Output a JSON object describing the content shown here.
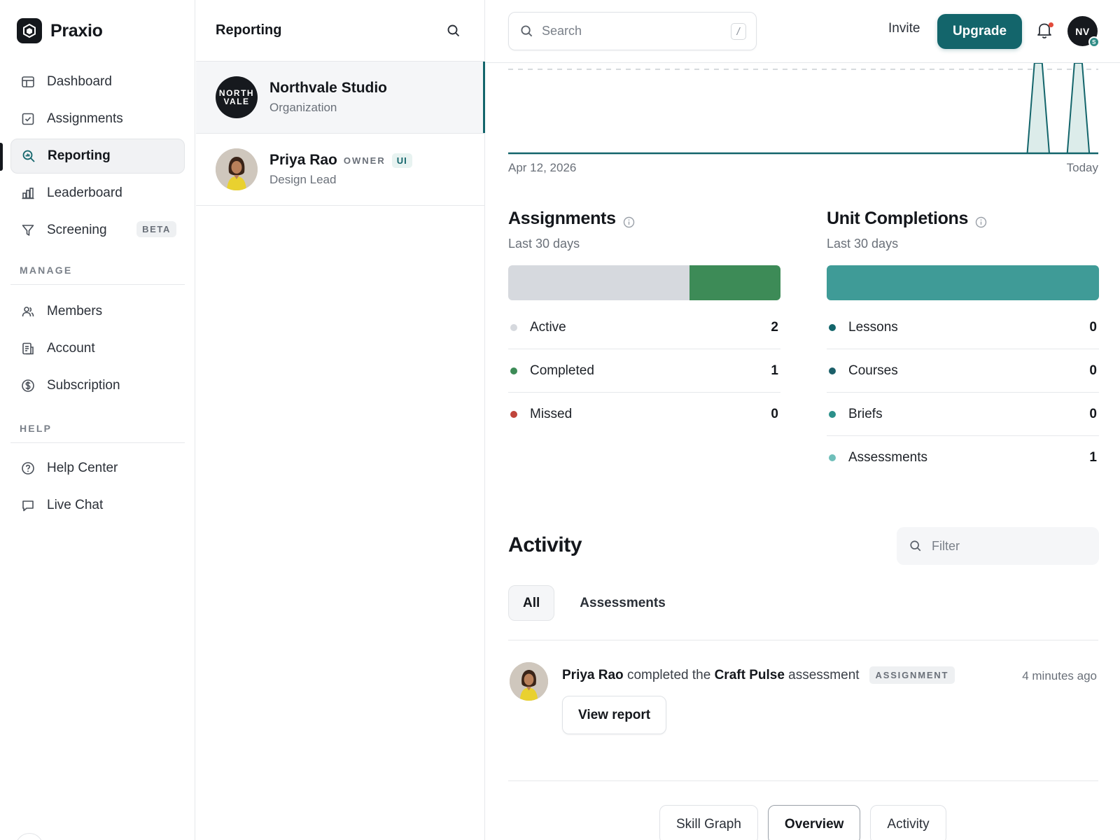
{
  "app": {
    "name": "Praxio"
  },
  "sidebar": {
    "items": [
      {
        "label": "Dashboard",
        "icon": "layout-icon"
      },
      {
        "label": "Assignments",
        "icon": "checkbox-icon"
      },
      {
        "label": "Reporting",
        "icon": "search-chart-icon",
        "active": true
      },
      {
        "label": "Leaderboard",
        "icon": "bar-chart-icon"
      },
      {
        "label": "Screening",
        "icon": "filter-icon",
        "badge": "BETA"
      }
    ],
    "manage_label": "MANAGE",
    "manage_items": [
      {
        "label": "Members",
        "icon": "users-icon"
      },
      {
        "label": "Account",
        "icon": "document-icon"
      },
      {
        "label": "Subscription",
        "icon": "dollar-circle-icon"
      }
    ],
    "help_label": "HELP",
    "help_items": [
      {
        "label": "Help Center",
        "icon": "help-circle-icon"
      },
      {
        "label": "Live Chat",
        "icon": "chat-icon"
      }
    ]
  },
  "list_panel": {
    "title": "Reporting",
    "entities": [
      {
        "name": "Northvale Studio",
        "subtitle": "Organization",
        "logo_lines": [
          "NORTH",
          "VALE"
        ],
        "selected": true
      },
      {
        "name": "Priya Rao",
        "role": "OWNER",
        "chip": "UI",
        "subtitle": "Design Lead"
      }
    ]
  },
  "topbar": {
    "search_placeholder": "Search",
    "search_shortcut": "/",
    "invite_label": "Invite",
    "upgrade_label": "Upgrade",
    "user_initials": "NV",
    "user_status": "S",
    "accent": "#13656b"
  },
  "trend": {
    "start_label": "Apr 12, 2026",
    "end_label": "Today",
    "values": [
      0,
      0,
      0,
      0,
      0,
      0,
      0,
      0,
      0,
      0,
      0,
      0,
      0,
      0,
      0,
      0,
      0,
      0,
      0,
      0,
      0,
      0,
      0,
      0,
      0,
      0,
      1,
      0,
      1,
      0
    ],
    "target_line": true
  },
  "assignments": {
    "title": "Assignments",
    "subtitle": "Last 30 days",
    "rows": [
      {
        "label": "Active",
        "value": 2,
        "color": "#d6d9de"
      },
      {
        "label": "Completed",
        "value": 1,
        "color": "#3d8b57"
      },
      {
        "label": "Missed",
        "value": 0,
        "color": "#c0443b"
      }
    ]
  },
  "unit_completions": {
    "title": "Unit Completions",
    "subtitle": "Last 30 days",
    "rows": [
      {
        "label": "Lessons",
        "value": 0,
        "color": "#13656b"
      },
      {
        "label": "Courses",
        "value": 0,
        "color": "#1b5f69"
      },
      {
        "label": "Briefs",
        "value": 0,
        "color": "#2b908a"
      },
      {
        "label": "Assessments",
        "value": 1,
        "color": "#6fbfba"
      }
    ],
    "bar_color": "#3f9b97"
  },
  "activity": {
    "title": "Activity",
    "filter_placeholder": "Filter",
    "tabs": [
      {
        "label": "All",
        "active": true
      },
      {
        "label": "Assessments"
      }
    ],
    "items": [
      {
        "actor": "Priya Rao",
        "verb": "completed the",
        "object": "Craft Pulse",
        "object_type": "assessment",
        "tag": "ASSIGNMENT",
        "time": "4 minutes ago",
        "action_label": "View report"
      }
    ]
  },
  "bottom_tabs": [
    {
      "label": "Skill Graph"
    },
    {
      "label": "Overview",
      "active": true
    },
    {
      "label": "Activity"
    }
  ]
}
